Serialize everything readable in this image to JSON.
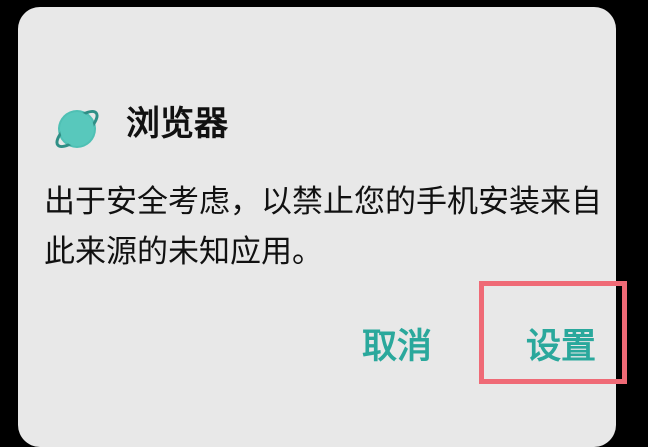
{
  "dialog": {
    "app_icon": "browser-planet-icon",
    "title": "浏览器",
    "message": "出于安全考虑，以禁止您的手机安装来自此来源的未知应用。",
    "cancel_label": "取消",
    "settings_label": "设置"
  },
  "colors": {
    "dialog_background": "#e8e8e8",
    "button_text": "#2aa89c",
    "highlight_box": "#ef6a76",
    "icon_teal": "#4fc0b4"
  }
}
